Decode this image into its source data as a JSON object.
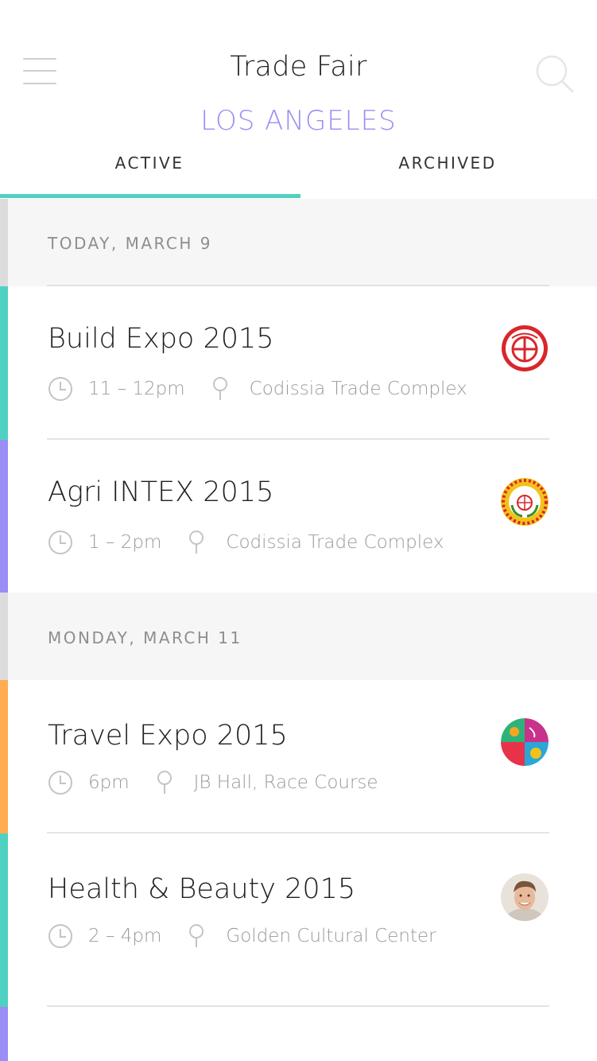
{
  "header": {
    "title": "Trade Fair",
    "city": "LOS ANGELES",
    "menu_icon": "hamburger-menu-icon",
    "search_icon": "search-icon"
  },
  "tabs": [
    {
      "label": "ACTIVE",
      "selected": true
    },
    {
      "label": "ARCHIVED",
      "selected": false
    }
  ],
  "colors": {
    "accent_city": "#9a8ef5",
    "tab_indicator": "#4fd1c2",
    "teal": "#4fd1c2",
    "purple": "#9a8ef5",
    "orange": "#ffad4f"
  },
  "sections": [
    {
      "label": "TODAY, MARCH 9",
      "events": [
        {
          "name": "Build Expo 2015",
          "time": "11 – 12pm",
          "location": "Codissia Trade Complex",
          "accent": "#4fd1c2",
          "logo": "codissia-logo"
        },
        {
          "name": "Agri INTEX 2015",
          "time": "1 – 2pm",
          "location": "Codissia Trade Complex",
          "accent": "#9a8ef5",
          "logo": "agri-intex-logo"
        }
      ]
    },
    {
      "label": "MONDAY, MARCH 11",
      "events": [
        {
          "name": "Travel Expo 2015",
          "time": "6pm",
          "location": "JB Hall, Race Course",
          "accent": "#ffad4f",
          "logo": "travel-expo-logo"
        },
        {
          "name": "Health & Beauty 2015",
          "time": "2 – 4pm",
          "location": "Golden Cultural Center",
          "accent": "#4fd1c2",
          "logo": "person-avatar"
        }
      ]
    }
  ]
}
